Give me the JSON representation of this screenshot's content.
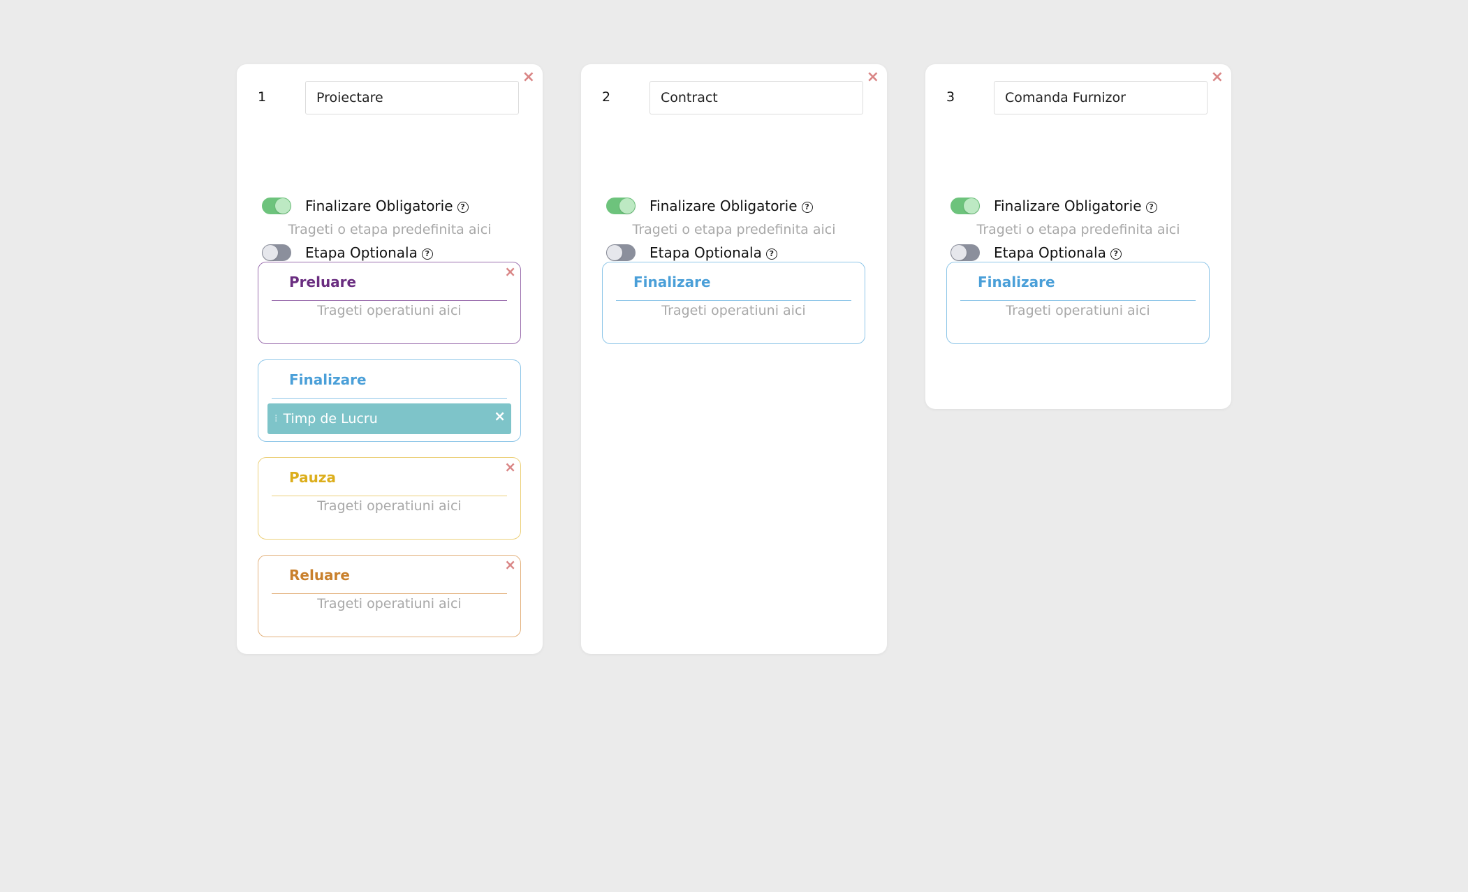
{
  "icons": {
    "close": "×",
    "help": "?",
    "drag": "⁞"
  },
  "colors": {
    "background": "#ebebeb",
    "toggle_on": "#6dc37c",
    "toggle_off": "#8b8f9c",
    "close": "#d98585",
    "preluare": "#7b3f8c",
    "finalizare": "#4a9fd8",
    "pauza": "#e0b431",
    "reluare": "#cf8b3c",
    "operation": "#7ec4c9"
  },
  "stages": [
    {
      "number": "1",
      "name": "Proiectare",
      "finalize_label": "Finalizare Obligatorie",
      "optional_label": "Etapa Optionala",
      "finalize_on": true,
      "optional_on": false,
      "drop_hint": "Trageti o etapa predefinita aici",
      "substages": [
        {
          "title": "Preluare",
          "hint": "Trageti operatiuni aici"
        },
        {
          "title": "Finalizare",
          "operation": "Timp de Lucru"
        },
        {
          "title": "Pauza",
          "hint": "Trageti operatiuni aici"
        },
        {
          "title": "Reluare",
          "hint": "Trageti operatiuni aici"
        }
      ]
    },
    {
      "number": "2",
      "name": "Contract",
      "finalize_label": "Finalizare Obligatorie",
      "optional_label": "Etapa Optionala",
      "finalize_on": true,
      "optional_on": false,
      "drop_hint": "Trageti o etapa predefinita aici",
      "substages": [
        {
          "title": "Finalizare",
          "hint": "Trageti operatiuni aici"
        }
      ]
    },
    {
      "number": "3",
      "name": "Comanda Furnizor",
      "finalize_label": "Finalizare Obligatorie",
      "optional_label": "Etapa Optionala",
      "finalize_on": true,
      "optional_on": false,
      "drop_hint": "Trageti o etapa predefinita aici",
      "substages": [
        {
          "title": "Finalizare",
          "hint": "Trageti operatiuni aici"
        }
      ]
    }
  ]
}
